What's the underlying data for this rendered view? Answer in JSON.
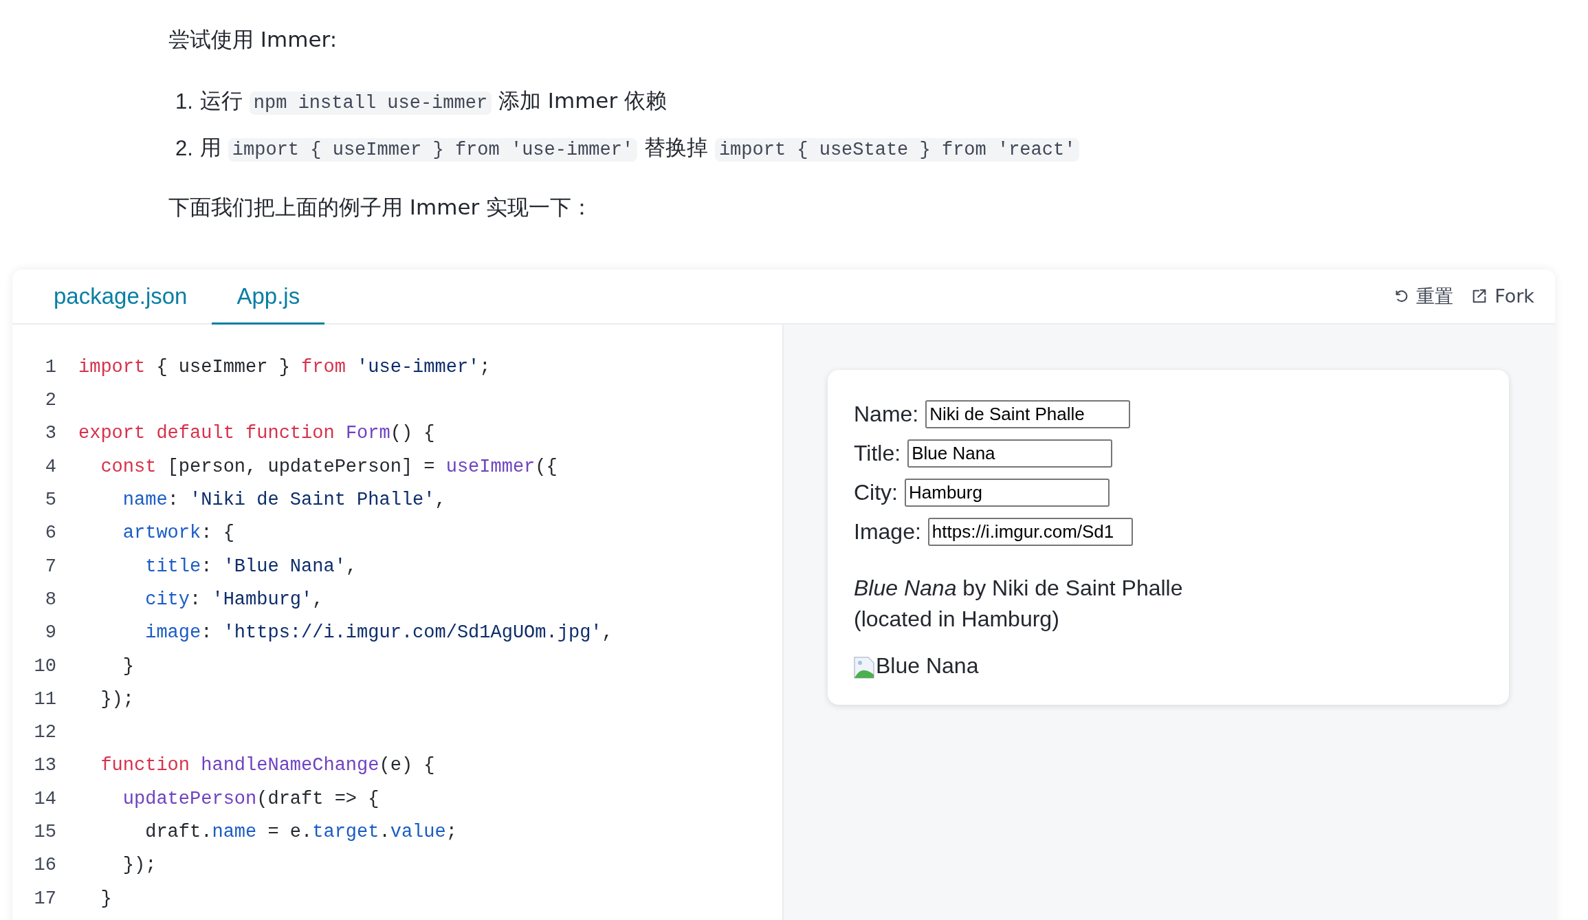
{
  "intro": "尝试使用 Immer:",
  "steps": [
    {
      "number": "1.",
      "parts": [
        {
          "kind": "text",
          "text": "运行 "
        },
        {
          "kind": "code",
          "text": "npm install use-immer"
        },
        {
          "kind": "text",
          "text": " 添加 Immer 依赖"
        }
      ]
    },
    {
      "number": "2.",
      "parts": [
        {
          "kind": "text",
          "text": "用 "
        },
        {
          "kind": "code",
          "text": "import { useImmer } from 'use-immer'"
        },
        {
          "kind": "text",
          "text": " 替换掉 "
        },
        {
          "kind": "code",
          "text": "import { useState } from 'react'"
        }
      ]
    }
  ],
  "outro": "下面我们把上面的例子用 Immer 实现一下：",
  "tabs": [
    {
      "label": "package.json",
      "selected": false
    },
    {
      "label": "App.js",
      "selected": true
    }
  ],
  "actions": [
    {
      "kind": "reset",
      "label": "重置"
    },
    {
      "kind": "fork",
      "label": "Fork"
    }
  ],
  "code": [
    {
      "number": "1",
      "tokens": [
        {
          "kind": "keyword",
          "text": "import"
        },
        {
          "kind": "plain",
          "text": " { useImmer } "
        },
        {
          "kind": "keyword",
          "text": "from"
        },
        {
          "kind": "string",
          "text": " 'use-immer'"
        },
        {
          "kind": "plain",
          "text": ";"
        }
      ]
    },
    {
      "number": "2"
    },
    {
      "number": "3",
      "tokens": [
        {
          "kind": "keyword",
          "text": "export default function "
        },
        {
          "kind": "function",
          "text": "Form"
        },
        {
          "kind": "plain",
          "text": "() {"
        }
      ]
    },
    {
      "number": "4",
      "tokens": [
        {
          "kind": "keyword",
          "text": "  const"
        },
        {
          "kind": "plain",
          "text": " [person, updatePerson] = "
        },
        {
          "kind": "function",
          "text": "useImmer"
        },
        {
          "kind": "plain",
          "text": "({"
        }
      ]
    },
    {
      "number": "5",
      "tokens": [
        {
          "kind": "property",
          "text": "    name"
        },
        {
          "kind": "plain",
          "text": ": "
        },
        {
          "kind": "string",
          "text": "'Niki de Saint Phalle'"
        },
        {
          "kind": "plain",
          "text": ","
        }
      ]
    },
    {
      "number": "6",
      "tokens": [
        {
          "kind": "property",
          "text": "    artwork"
        },
        {
          "kind": "plain",
          "text": ": {"
        }
      ]
    },
    {
      "number": "7",
      "tokens": [
        {
          "kind": "property",
          "text": "      title"
        },
        {
          "kind": "plain",
          "text": ": "
        },
        {
          "kind": "string",
          "text": "'Blue Nana'"
        },
        {
          "kind": "plain",
          "text": ","
        }
      ]
    },
    {
      "number": "8",
      "tokens": [
        {
          "kind": "property",
          "text": "      city"
        },
        {
          "kind": "plain",
          "text": ": "
        },
        {
          "kind": "string",
          "text": "'Hamburg'"
        },
        {
          "kind": "plain",
          "text": ","
        }
      ]
    },
    {
      "number": "9",
      "tokens": [
        {
          "kind": "property",
          "text": "      image"
        },
        {
          "kind": "plain",
          "text": ": "
        },
        {
          "kind": "string",
          "text": "'https://i.imgur.com/Sd1AgUOm.jpg'"
        },
        {
          "kind": "plain",
          "text": ","
        }
      ]
    },
    {
      "number": "10",
      "tokens": [
        {
          "kind": "plain",
          "text": "    }"
        }
      ]
    },
    {
      "number": "11",
      "tokens": [
        {
          "kind": "plain",
          "text": "  });"
        }
      ]
    },
    {
      "number": "12"
    },
    {
      "number": "13",
      "tokens": [
        {
          "kind": "keyword",
          "text": "  function "
        },
        {
          "kind": "function",
          "text": "handleNameChange"
        },
        {
          "kind": "plain",
          "text": "(e) {"
        }
      ]
    },
    {
      "number": "14",
      "tokens": [
        {
          "kind": "function",
          "text": "    updatePerson"
        },
        {
          "kind": "plain",
          "text": "(draft => {"
        }
      ]
    },
    {
      "number": "15",
      "tokens": [
        {
          "kind": "plain",
          "text": "      draft."
        },
        {
          "kind": "property",
          "text": "name"
        },
        {
          "kind": "plain",
          "text": " = e."
        },
        {
          "kind": "property",
          "text": "target"
        },
        {
          "kind": "plain",
          "text": "."
        },
        {
          "kind": "property",
          "text": "value"
        },
        {
          "kind": "plain",
          "text": ";"
        }
      ]
    },
    {
      "number": "16",
      "tokens": [
        {
          "kind": "plain",
          "text": "    });"
        }
      ]
    },
    {
      "number": "17",
      "tokens": [
        {
          "kind": "plain",
          "text": "  }"
        }
      ]
    }
  ],
  "preview": {
    "fields": [
      {
        "label": "Name:",
        "value": "Niki de Saint Phalle"
      },
      {
        "label": "Title:",
        "value": "Blue Nana"
      },
      {
        "label": "City:",
        "value": "Hamburg"
      },
      {
        "label": "Image:",
        "value": "https://i.imgur.com/Sd1"
      }
    ],
    "description": [
      "*Blue Nana* by Niki de Saint Phalle",
      "(located in Hamburg)"
    ],
    "image_alt": "Blue Nana"
  }
}
